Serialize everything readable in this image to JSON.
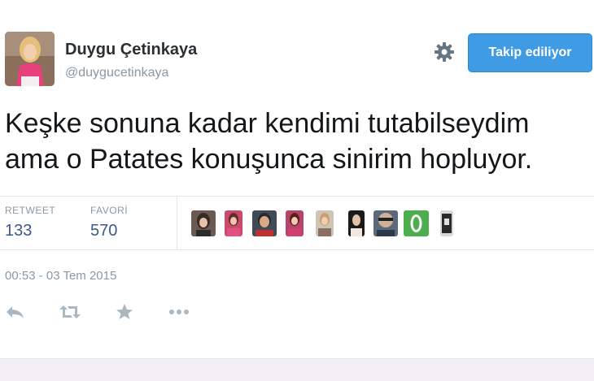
{
  "user": {
    "display_name": "Duygu Çetinkaya",
    "handle": "@duygucetinkaya"
  },
  "header": {
    "follow_button_label": "Takip ediliyor",
    "settings_icon": "gear-icon"
  },
  "tweet": {
    "lines": [
      "Keşke sonuna kadar kendimi tutabilseydim",
      "ama o Patates konuşunca sinirim hopluyor."
    ],
    "timestamp": "00:53 - 03 Tem 2015"
  },
  "stats": {
    "retweet_label": "RETWEET",
    "retweet_count": "133",
    "favorite_label": "FAVORİ",
    "favorite_count": "570"
  },
  "actions": [
    {
      "icon": "reply-icon"
    },
    {
      "icon": "retweet-icon"
    },
    {
      "icon": "star-icon"
    },
    {
      "icon": "more-icon"
    }
  ],
  "colors": {
    "accent": "#3f9ce4",
    "stat_value": "#3b5a8a",
    "muted": "#8899a6"
  }
}
